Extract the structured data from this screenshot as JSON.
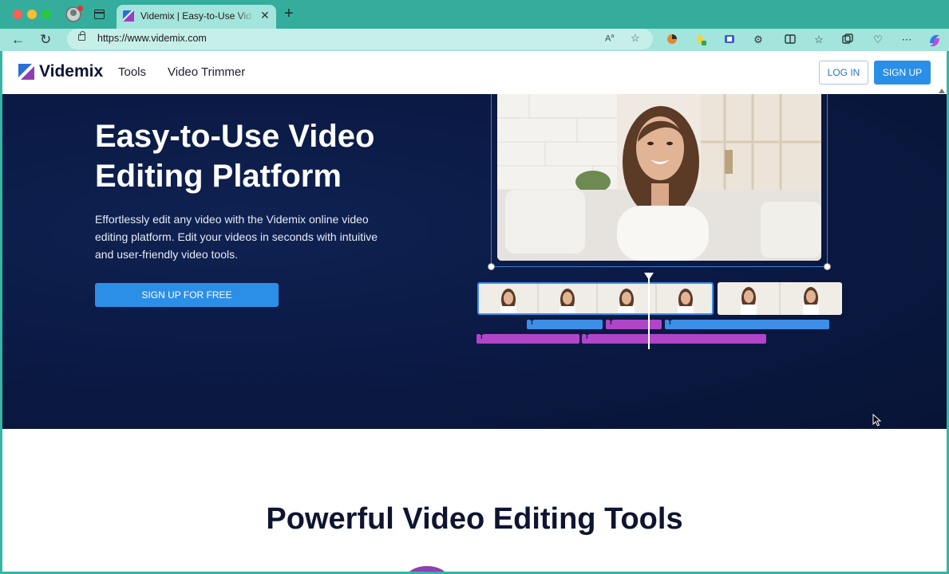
{
  "browser": {
    "tab_title": "Videmix | Easy-to-Use Video Editing Platform",
    "tab_close": "✕",
    "new_tab": "+",
    "url": "https://www.videmix.com",
    "back": "←",
    "reload": "↻"
  },
  "site": {
    "logo_text": "Videmix",
    "nav": [
      "Tools",
      "Video Trimmer"
    ],
    "login_label": "LOG IN",
    "signup_label": "SIGN UP"
  },
  "hero": {
    "title_line1": "Easy-to-Use Video",
    "title_line2": "Editing Platform",
    "description": "Effortlessly edit any video with the Videmix online video editing platform. Edit your videos in seconds with intuitive and user-friendly video tools.",
    "cta_label": "SIGN UP FOR FREE",
    "track_marker": "T"
  },
  "section": {
    "title": "Powerful Video Editing Tools"
  },
  "colors": {
    "accent": "#2b8fe8",
    "hero_bg": "#0b1a45",
    "track_blue": "#3d8ee6",
    "track_purple": "#b045c8",
    "browser_frame": "#37b5a4"
  }
}
